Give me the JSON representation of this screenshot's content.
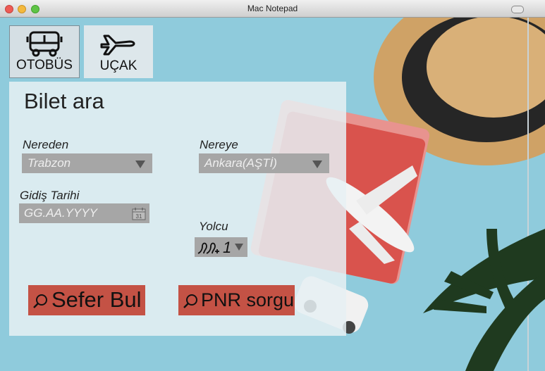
{
  "window": {
    "title": "Mac Notepad"
  },
  "tabs": [
    {
      "label": "OTOBÜS",
      "icon": "bus-icon",
      "selected": true
    },
    {
      "label": "UÇAK",
      "icon": "airplane-icon",
      "selected": false
    }
  ],
  "panel": {
    "title": "Bilet ara",
    "from": {
      "label": "Nereden",
      "value": "Trabzon"
    },
    "to": {
      "label": "Nereye",
      "value": "Ankara(AŞTİ)"
    },
    "date": {
      "label": "Gidiş Tarihi",
      "placeholder": "GG.AA.YYYY",
      "calendar_day": "31"
    },
    "passengers": {
      "label": "Yolcu",
      "value": "1",
      "icon": "passengers-icon"
    },
    "buttons": {
      "search_trip": "Sefer Bul",
      "pnr_query": "PNR sorgu"
    }
  },
  "colors": {
    "accent_button": "#c45245",
    "field_bg": "#a6a6a6",
    "background": "#8fcbdc"
  }
}
